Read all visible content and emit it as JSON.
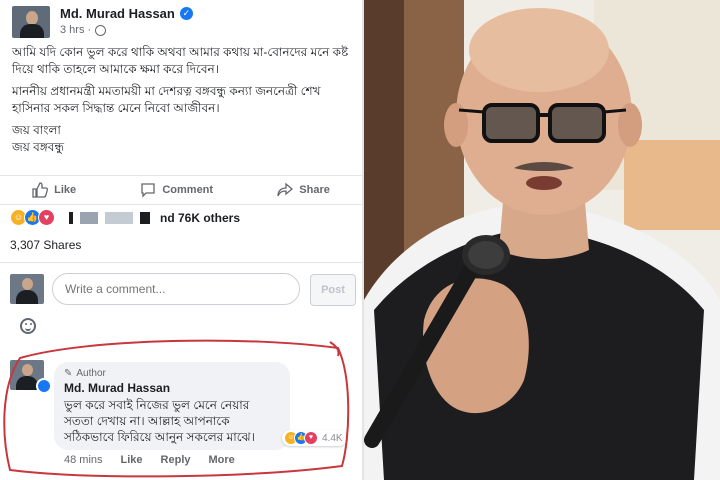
{
  "post": {
    "author": "Md. Murad Hassan",
    "time": "3 hrs ·",
    "paragraphs": [
      "আমি যদি কোন ভুল করে থাকি অথবা আমার কথায় মা-বোনদের মনে কষ্ট দিয়ে থাকি তাহলে আমাকে ক্ষমা করে দিবেন।",
      "মাননীয় প্রধানমন্ত্রী মমতাময়ী মা দেশরত্ন বঙ্গবন্ধু কন্যা জননেত্রী শেখ হাসিনার সকল সিদ্ধান্ত মেনে নিবো আজীবন।",
      "জয় বাংলা\nজয় বঙ্গবন্ধু"
    ],
    "actions": {
      "like": "Like",
      "comment": "Comment",
      "share": "Share"
    },
    "reactions_text": "nd 76K others",
    "shares": "3,307 Shares"
  },
  "composer": {
    "placeholder": "Write a comment...",
    "post_button": "Post"
  },
  "comment": {
    "tag": "Author",
    "author": "Md. Murad Hassan",
    "text": "ভুল করে সবাই নিজের ভুল মেনে নেয়ার সততা দেখায় না। আল্লাহ আপনাকে সঠিকভাবে ফিরিয়ে আনুন সকলের মাঝে।",
    "reaction_count": "4.4K",
    "time": "48 mins",
    "like": "Like",
    "reply": "Reply",
    "more": "More"
  },
  "colors": {
    "facebook_blue": "#1877f2",
    "annotation_red": "#c8373b",
    "muted_text": "#65676b"
  },
  "icons": [
    "verified-icon",
    "globe-icon",
    "like-icon",
    "comment-icon",
    "share-icon",
    "smiley-icon",
    "pen-icon"
  ]
}
